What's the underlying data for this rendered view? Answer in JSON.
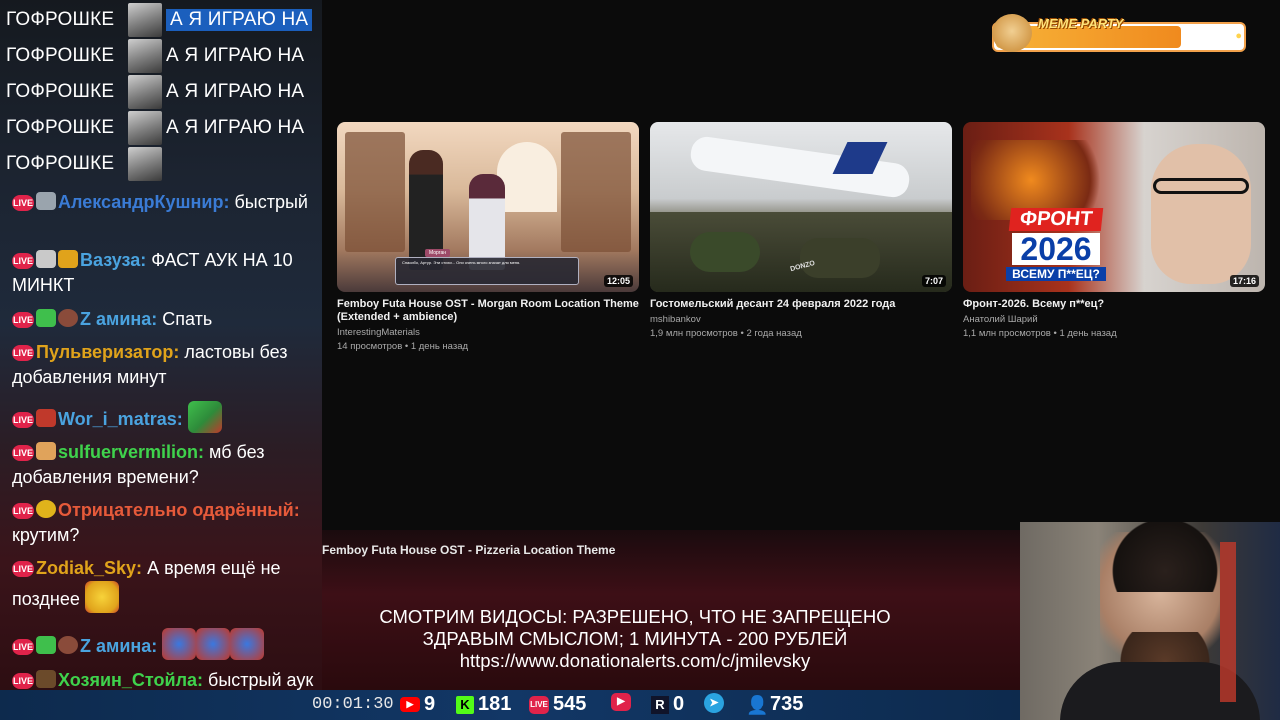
{
  "chat": {
    "spam_word1": "ГОФРОШКЕ",
    "spam_word2": "А Я ИГРАЮ НА",
    "messages": [
      {
        "nick": "АлександрКушнир:",
        "text": "быстрый",
        "color": "#3a7bd5"
      },
      {
        "nick": "Вазуза:",
        "text": "ФАСТ АУК НА 10 МИНКТ",
        "color": "#4aa3df"
      },
      {
        "nick": "Z амина:",
        "text": "Спать",
        "color": "#4aa3df"
      },
      {
        "nick": "Пульверизатор:",
        "text": "ластовы без добавления минут",
        "color": "#e0a31b"
      },
      {
        "nick": "Wor_i_matras:",
        "text": "",
        "color": "#4aa3df"
      },
      {
        "nick": "sulfuervermilion:",
        "text": "мб без добавления времени?",
        "color": "#3fd24c"
      },
      {
        "nick": "Отрицательно одарённый:",
        "text": "крутим?",
        "color": "#e65a3a"
      },
      {
        "nick": "Zodiak_Sky:",
        "text": "А время ещё не позднее",
        "color": "#e0a31b"
      },
      {
        "nick": "Z амина:",
        "text": "",
        "color": "#4aa3df"
      },
      {
        "nick": "Хозяин_Стойла:",
        "text": "быстрый аук",
        "color": "#3fd24c"
      }
    ],
    "live_badge": "LIVE"
  },
  "stats": {
    "timer": "00:01:30",
    "youtube": "9",
    "kick": "181",
    "vklive": "545",
    "rutube": "0",
    "telegram": "",
    "viewers": "735"
  },
  "videos": [
    {
      "title": "Femboy Futa House OST - Morgan Room Location Theme (Extended + ambience)",
      "channel": "InterestingMaterials",
      "meta": "14 просмотров • 1 день назад",
      "duration": "12:05"
    },
    {
      "title": "Гостомельский десант 24 февраля 2022 года",
      "channel": "mshibankov",
      "meta": "1,9 млн просмотров • 2 года назад",
      "duration": "7:07"
    },
    {
      "title": "Фронт-2026. Всему п**ец?",
      "channel": "Анатолий Шарий",
      "meta": "1,1 млн просмотров • 1 день назад",
      "duration": "17:16"
    }
  ],
  "thumb_texts": {
    "v1_dialog": "Спасибо, Артур. Эти стихи... Они очень много значат для меня.",
    "v1_name": "Морган",
    "v3_l1": "ФРОНТ",
    "v3_l2": "2026",
    "v3_l3": "ВСЕМУ П**ЕЦ?",
    "v2_tag": "DONZO"
  },
  "now_playing": "Femboy Futa House OST - Pizzeria Location Theme",
  "rules": {
    "line1": "СМОТРИМ ВИДОСЫ: РАЗРЕШЕНО, ЧТО НЕ ЗАПРЕЩЕНО",
    "line2": "ЗДРАВЫМ СМЫСЛОМ; 1 МИНУТА - 200 РУБЛЕЙ",
    "line3": "https://www.donationalerts.com/c/jmilevsky"
  },
  "meme_party": {
    "title": "MEME PARTY",
    "count": "740 / 1000",
    "progress": 0.74
  },
  "colors": {
    "accent": "#e0234a",
    "statbar": "#123766"
  }
}
